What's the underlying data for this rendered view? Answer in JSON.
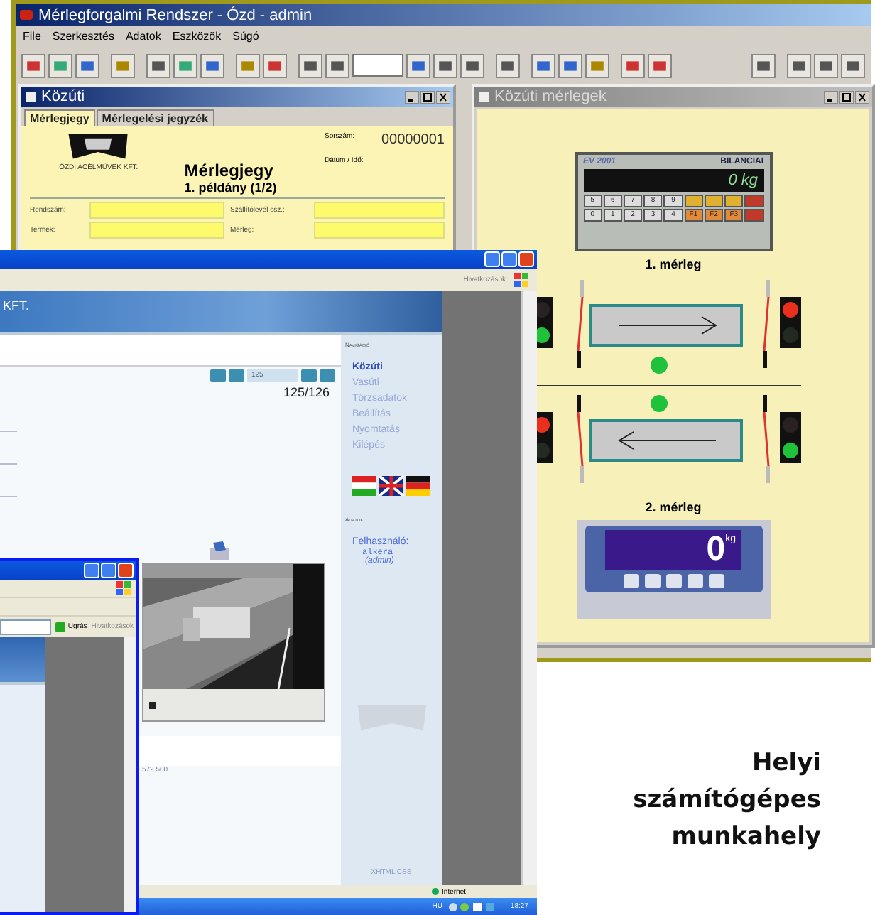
{
  "main_window": {
    "title": "Mérlegforgalmi Rendszer - Ózd - admin",
    "menu": [
      "File",
      "Szerkesztés",
      "Adatok",
      "Eszközök",
      "Súgó"
    ]
  },
  "ticket_window": {
    "title": "Közúti",
    "tabs": [
      {
        "label": "Mérlegjegy",
        "selected": true
      },
      {
        "label": "Mérlegelési jegyzék",
        "selected": false
      }
    ],
    "company": "ÓZDI ACÉLMŰVEK KFT.",
    "doc_title": "Mérlegjegy",
    "copy": "1. példány (1/2)",
    "serial_label": "Sorszám:",
    "serial": "00000001",
    "date_label": "Dátum / Idő:",
    "fields": [
      {
        "label": "Rendszám:"
      },
      {
        "label": "Szállítólevél ssz.:"
      },
      {
        "label": "Termék:"
      },
      {
        "label": "Mérleg:"
      }
    ]
  },
  "scales_window": {
    "title": "Közúti mérlegek",
    "scales": [
      {
        "name": "1. mérleg",
        "reversed": false,
        "lamp_on": true,
        "lights": [
          {
            "red_on": false,
            "green_on": true
          },
          {
            "red_on": true,
            "green_on": false
          }
        ],
        "display": {
          "kind": "keypad",
          "model": "EV 2001",
          "brand": "BILANCIAI",
          "reading": "0 kg",
          "keys": [
            "5",
            "6",
            "7",
            "8",
            "9",
            "0",
            "1",
            "2",
            "3",
            "4",
            "F1",
            "F2",
            "F3"
          ]
        }
      },
      {
        "name": "2. mérleg",
        "reversed": true,
        "lamp_on": true,
        "lights": [
          {
            "red_on": true,
            "green_on": false
          },
          {
            "red_on": false,
            "green_on": true
          }
        ],
        "display": {
          "kind": "panel",
          "reading": "0",
          "unit": "kg"
        }
      }
    ]
  },
  "browser": {
    "links_label": "Hivatkozások",
    "header_text": "KFT.",
    "pager": {
      "value": "125",
      "count": "125/126"
    },
    "nav_heading": "Navigáció",
    "nav": [
      {
        "label": "Közúti",
        "selected": true
      },
      {
        "label": "Vasúti",
        "selected": false
      },
      {
        "label": "Törzsadatok",
        "selected": false
      },
      {
        "label": "Beállítás",
        "selected": false
      },
      {
        "label": "Nyomtatás",
        "selected": false
      },
      {
        "label": "Kilépés",
        "selected": false
      }
    ],
    "data_heading": "Adatok",
    "user_label": "Felhasználó:",
    "user": "alkera",
    "role": "(admin)",
    "footer_left": "572 500",
    "footer_right": "XHTML CSS",
    "status": "Internet",
    "lang": "HU",
    "clock": "18:27"
  },
  "small_browser": {
    "go": "Ugrás",
    "links_label": "Hivatkozások"
  },
  "caption": "Helyi számítógépes munkahely"
}
